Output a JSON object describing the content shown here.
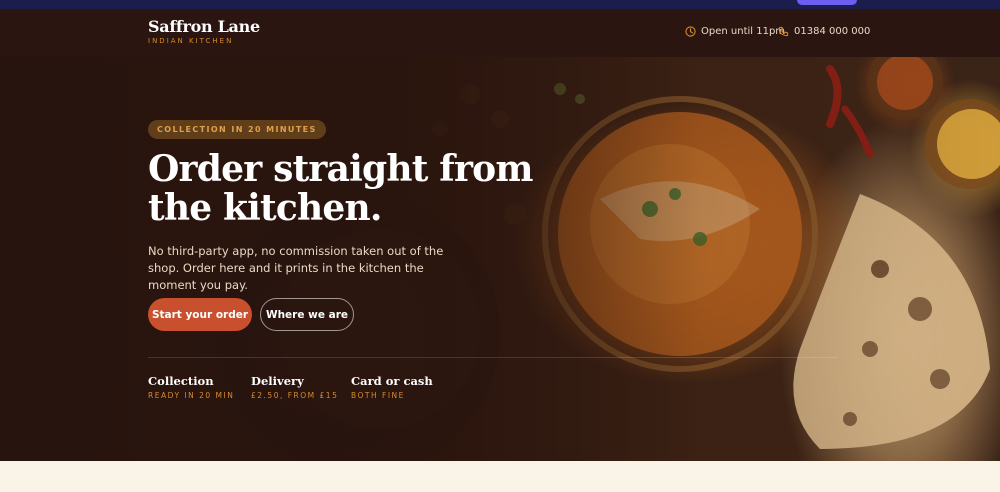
{
  "brand": {
    "name": "Saffron Lane",
    "tagline": "INDIAN KITCHEN"
  },
  "nav": {
    "hours": "Open until 11pm",
    "phone": "01384 000 000"
  },
  "hero": {
    "badge": "COLLECTION IN 20 MINUTES",
    "headline": "Order straight from the kitchen.",
    "lead": "No third-party app, no commission taken out of the shop. Order here and it prints in the kitchen the moment you pay.",
    "primary_cta": "Start your order",
    "secondary_cta": "Where we are"
  },
  "stats": [
    {
      "title": "Collection",
      "sub": "READY IN 20 MIN"
    },
    {
      "title": "Delivery",
      "sub": "£2.50, FROM £15"
    },
    {
      "title": "Card or cash",
      "sub": "BOTH FINE"
    }
  ],
  "colors": {
    "accent": "#c9502e",
    "gold": "#d98b2c",
    "nav_bg": "#2a1511",
    "page_bg": "#faf3e8"
  },
  "icons": {
    "hours": "clock-icon",
    "phone": "phone-icon"
  }
}
